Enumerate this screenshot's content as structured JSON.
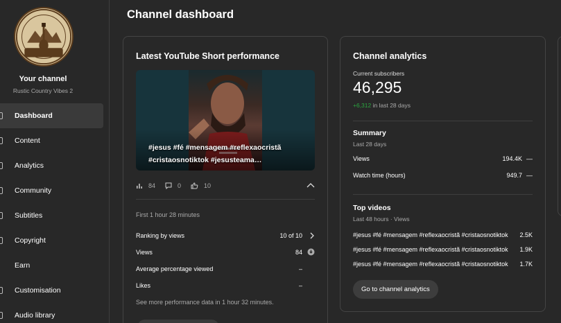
{
  "page_title": "Channel dashboard",
  "channel": {
    "logo_text_top": "RUSTIC COUNTRY",
    "logo_text_bottom": "VIBES",
    "title": "Your channel",
    "name": "Rustic Country Vibes 2"
  },
  "sidebar": {
    "items": [
      {
        "label": "Dashboard",
        "active": true
      },
      {
        "label": "Content"
      },
      {
        "label": "Analytics"
      },
      {
        "label": "Community"
      },
      {
        "label": "Subtitles"
      },
      {
        "label": "Copyright"
      },
      {
        "label": "Earn"
      },
      {
        "label": "Customisation"
      },
      {
        "label": "Audio library"
      }
    ]
  },
  "short_card": {
    "title": "Latest YouTube Short performance",
    "caption": "#jesus #fé #mensagem #reflexaocristã #cristaosnotiktok #jesusteama…",
    "stats": {
      "views": "84",
      "comments": "0",
      "likes": "10"
    },
    "first_period": "First 1 hour 28 minutes",
    "metrics": [
      {
        "label": "Ranking by views",
        "value": "10 of 10"
      },
      {
        "label": "Views",
        "value": "84"
      },
      {
        "label": "Average percentage viewed",
        "value": "–"
      },
      {
        "label": "Likes",
        "value": "–"
      }
    ],
    "see_more": "See more performance data in 1 hour 32 minutes."
  },
  "analytics_card": {
    "title": "Channel analytics",
    "subscribers_label": "Current subscribers",
    "subscribers": "46,295",
    "delta": "+6,312",
    "delta_suffix": "in last 28 days",
    "summary_title": "Summary",
    "summary_period": "Last 28 days",
    "summary": [
      {
        "label": "Views",
        "value": "194.4K",
        "trend": "—"
      },
      {
        "label": "Watch time (hours)",
        "value": "949.7",
        "trend": "—"
      }
    ],
    "top_title": "Top videos",
    "top_sub": "Last 48 hours · Views",
    "top_videos": [
      {
        "title": "#jesus #fé #mensagem #reflexaocristã #cristaosnotiktok",
        "views": "2.5K"
      },
      {
        "title": "#jesus #fé #mensagem #reflexaocristã #cristaosnotiktok",
        "views": "1.9K"
      },
      {
        "title": "#jesus #fé #mensagem #reflexaocristã #cristaosnotiktok",
        "views": "1.7K"
      }
    ],
    "button": "Go to channel analytics"
  }
}
